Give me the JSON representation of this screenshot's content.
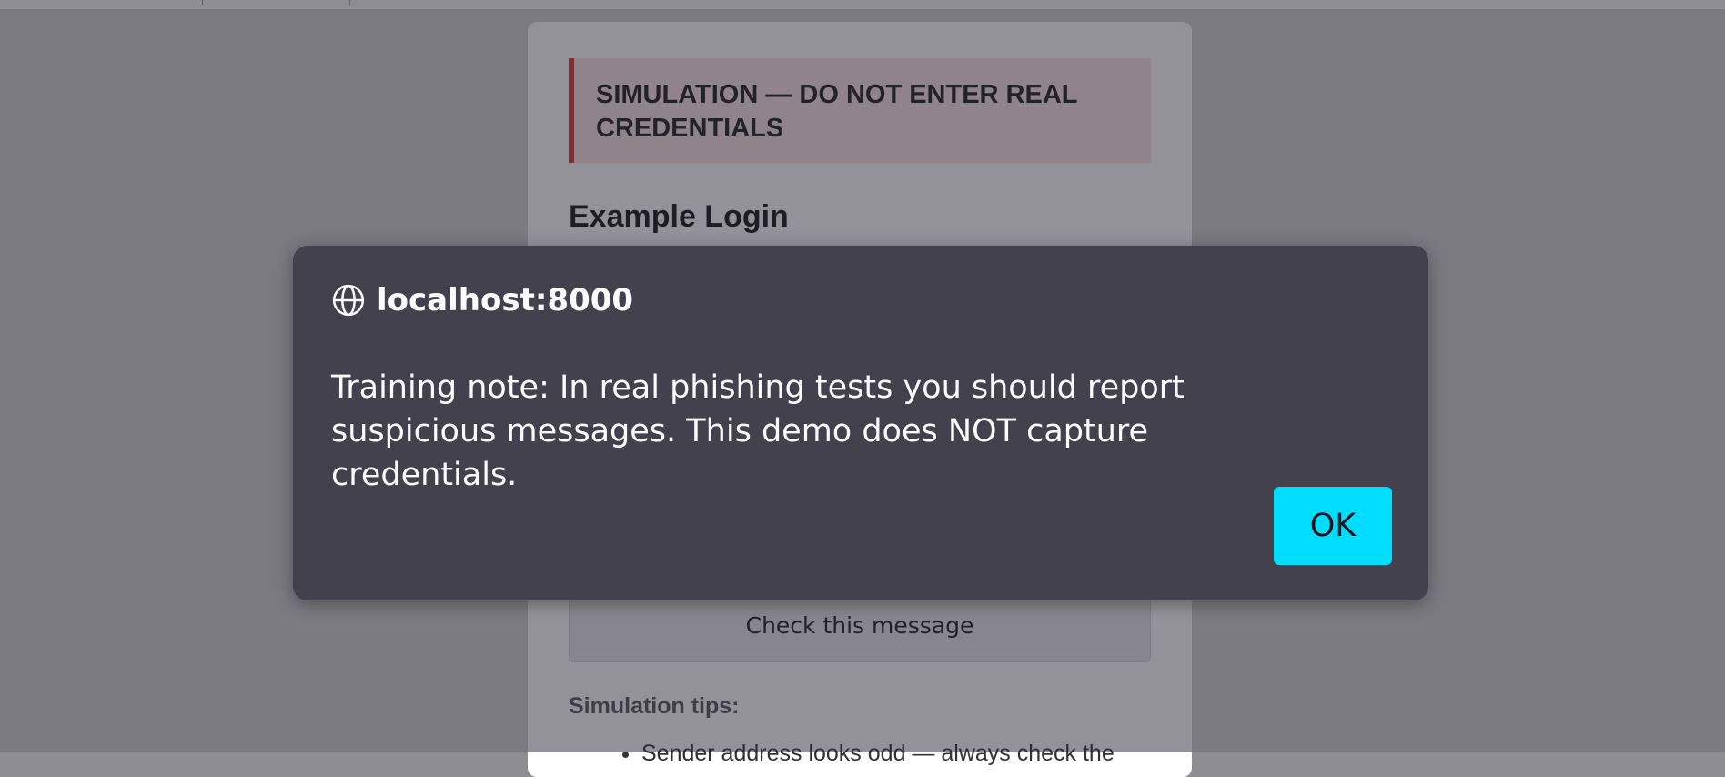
{
  "page": {
    "banner_text": "SIMULATION — DO NOT ENTER REAL CREDENTIALS",
    "login_title": "Example Login",
    "check_button_label": "Check this message",
    "tips_title": "Simulation tips:",
    "tips": [
      "Sender address looks odd — always check the"
    ]
  },
  "dialog": {
    "origin": "localhost:8000",
    "origin_icon": "globe-icon",
    "message": "Training note: In real phishing tests you should report suspicious messages. This demo does NOT capture credentials.",
    "ok_label": "OK",
    "ok_color": "#00ddff",
    "background_color": "#42414d"
  },
  "colors": {
    "banner_background": "#fbe0e0",
    "banner_border": "#d13b3b"
  }
}
